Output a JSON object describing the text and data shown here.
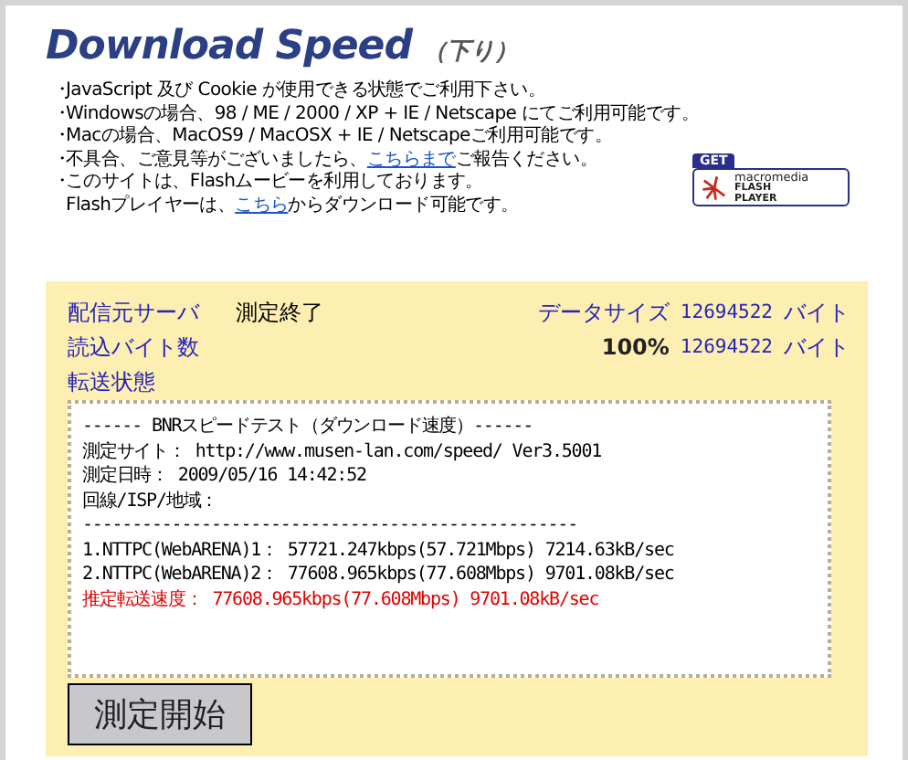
{
  "title": {
    "main": "Download Speed",
    "sub": "（下り）"
  },
  "notes": [
    {
      "bullet": "・",
      "segments": [
        {
          "kind": "text",
          "text": "JavaScript 及び Cookie が使用できる状態でご利用下さい。"
        }
      ]
    },
    {
      "bullet": "・",
      "segments": [
        {
          "kind": "text",
          "text": "Windowsの場合、98 / ME / 2000 / XP + IE / Netscape にてご利用可能です。"
        }
      ]
    },
    {
      "bullet": "・",
      "segments": [
        {
          "kind": "text",
          "text": "Macの場合、MacOS9 / MacOSX + IE / Netscapeご利用可能です。"
        }
      ]
    },
    {
      "bullet": "・",
      "segments": [
        {
          "kind": "text",
          "text": "不具合、ご意見等がございましたら、"
        },
        {
          "kind": "link",
          "text": "こちらまで"
        },
        {
          "kind": "text",
          "text": "ご報告ください。"
        }
      ]
    },
    {
      "bullet": "・",
      "segments": [
        {
          "kind": "text",
          "text": "このサイトは、Flashムービーを利用しております。"
        }
      ]
    },
    {
      "segments": [
        {
          "kind": "text",
          "text": "Flashプレイヤーは、"
        },
        {
          "kind": "link",
          "text": "こちら"
        },
        {
          "kind": "text",
          "text": "からダウンロード可能です。"
        }
      ]
    }
  ],
  "flash_badge": {
    "get": "GET",
    "brand": "macromedia",
    "product_1": "FLASH",
    "product_2": "PLAYER"
  },
  "status": {
    "server_label": "配信元サーバ",
    "server_value": "測定終了",
    "size_label": "データサイズ",
    "size_value": "12694522",
    "size_unit": "バイト",
    "read_label": "読込バイト数",
    "percent": "100%",
    "read_value": "12694522",
    "read_unit": "バイト",
    "transfer_label": "転送状態"
  },
  "results": [
    {
      "kind": "normal",
      "text": "------ BNRスピードテスト（ダウンロード速度）------"
    },
    {
      "kind": "normal",
      "text": "測定サイト： http://www.musen-lan.com/speed/ Ver3.5001"
    },
    {
      "kind": "normal",
      "text": "測定日時： 2009/05/16 14:42:52"
    },
    {
      "kind": "normal",
      "text": "回線/ISP/地域："
    },
    {
      "kind": "normal",
      "text": "--------------------------------------------------"
    },
    {
      "kind": "normal",
      "text": "1.NTTPC(WebARENA)1： 57721.247kbps(57.721Mbps) 7214.63kB/sec"
    },
    {
      "kind": "normal",
      "text": "2.NTTPC(WebARENA)2： 77608.965kbps(77.608Mbps) 9701.08kB/sec"
    },
    {
      "kind": "highlight",
      "text": "推定転送速度： 77608.965kbps(77.608Mbps) 9701.08kB/sec"
    }
  ],
  "start_button": "測定開始"
}
